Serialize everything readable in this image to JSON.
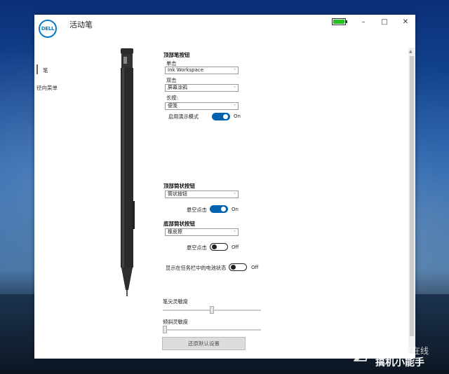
{
  "app": {
    "logo_text": "DELL",
    "title": "活动笔",
    "battery_level": 1.0,
    "battery_color": "#1fc21f"
  },
  "window_controls": {
    "minimize": "–",
    "maximize": "□",
    "close": "✕"
  },
  "sidebar": {
    "items": [
      {
        "label": "笔",
        "selected": true
      },
      {
        "label": "径向菜单",
        "selected": false
      }
    ]
  },
  "top_button": {
    "heading": "顶部笔按钮",
    "single_label": "单击",
    "single_value": "Ink Workspace",
    "double_label": "双击",
    "double_value": "屏幕涂鸦",
    "long_label": "长按:",
    "long_value": "便笺",
    "present_label": "启用演示模式",
    "present_state": "On",
    "present_on": true
  },
  "top_barrel": {
    "heading": "顶部筒状按钮",
    "value": "筒状按钮",
    "hover_label": "悬空点击",
    "hover_state": "On",
    "hover_on": true
  },
  "bottom_barrel": {
    "heading": "底部筒状按钮",
    "value": "橡皮擦",
    "hover_label": "悬空点击",
    "hover_state": "Off",
    "hover_on": false
  },
  "taskbar_battery": {
    "label": "显示在任务栏中的电池状态",
    "state": "Off",
    "on": false
  },
  "sensitivity": {
    "tip_label": "笔尖灵敏度",
    "tip_value": 0.5,
    "tilt_label": "倾斜灵敏度",
    "tilt_value": 0.0
  },
  "reset_label": "还原默认设置",
  "dropdown_caret": "˅",
  "watermark": {
    "line1": "电脑爱好在线",
    "line2": "搞机小能手"
  }
}
